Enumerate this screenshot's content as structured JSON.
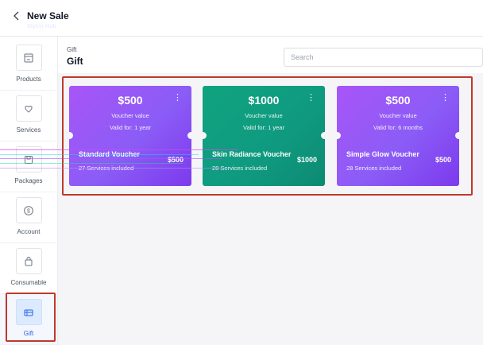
{
  "header": {
    "title": "New Sale",
    "subtitle": "Stylist Hub"
  },
  "sidebar": {
    "items": [
      {
        "label": "Products",
        "icon": "store-icon"
      },
      {
        "label": "Services",
        "icon": "heart-hand-icon"
      },
      {
        "label": "Packages",
        "icon": "box-icon"
      },
      {
        "label": "Account",
        "icon": "dollar-circle-icon"
      },
      {
        "label": "Consumable",
        "icon": "bag-icon"
      },
      {
        "label": "Gift",
        "icon": "gift-card-icon",
        "active": true
      }
    ]
  },
  "main": {
    "breadcrumb": "Gift",
    "title": "Gift",
    "search": {
      "placeholder": "Search",
      "value": ""
    }
  },
  "cards": [
    {
      "price": "$500",
      "voucher_label": "Voucher value",
      "valid": "Valid for: 1 year",
      "name": "Standard Voucher",
      "services": "27 Services included",
      "amount": "$500",
      "theme": "purple"
    },
    {
      "price": "$1000",
      "voucher_label": "Voucher value",
      "valid": "Valid for: 1 year",
      "name": "Skin Radiance Voucher",
      "services": "28 Services included",
      "amount": "$1000",
      "theme": "green"
    },
    {
      "price": "$500",
      "voucher_label": "Voucher value",
      "valid": "Valid for: 6 months",
      "name": "Simple Glow Voucher",
      "services": "28 Services included",
      "amount": "$500",
      "theme": "purple"
    }
  ],
  "colors": {
    "accent": "#2563eb",
    "card_purple": "#8b5cf6",
    "card_green": "#0f9a80",
    "highlight": "#c0392b"
  }
}
